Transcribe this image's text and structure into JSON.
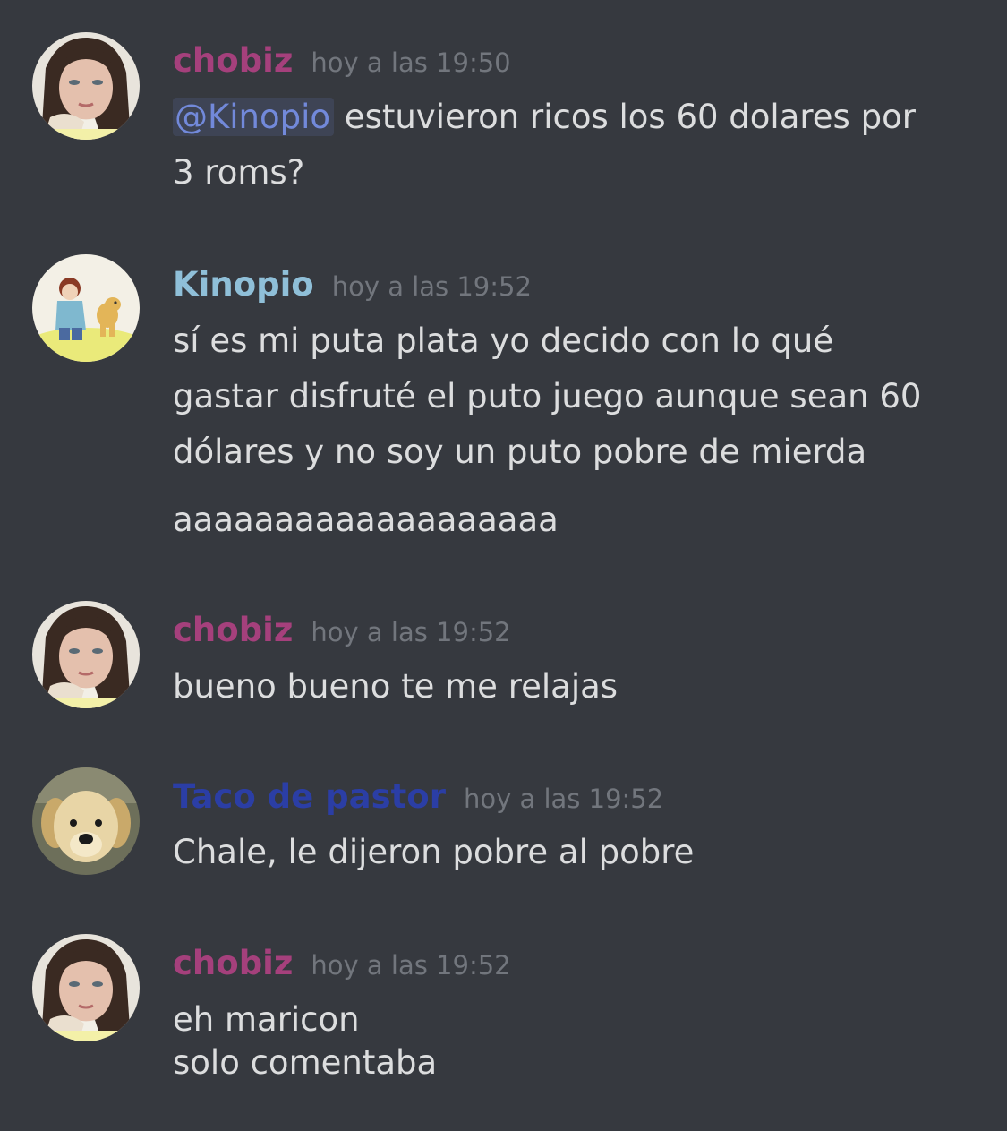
{
  "colors": {
    "background": "#36393f",
    "text": "#dcddde",
    "timestamp": "#72767d",
    "mention": "#7289da",
    "user_chobiz": "#a5407c",
    "user_kinopio": "#8fbfd8",
    "user_taco": "#2b3ea5"
  },
  "messages": [
    {
      "username": "chobiz",
      "timestamp": "hoy a las 19:50",
      "avatar": "girl-portrait-avatar",
      "mention": "@Kinopio",
      "lines": [
        " estuvieron ricos los 60 dolares por",
        "3 roms?"
      ]
    },
    {
      "username": "Kinopio",
      "timestamp": "hoy a las 19:52",
      "avatar": "boy-and-dog-cartoon-avatar",
      "lines": [
        "sí es mi puta plata yo decido con lo qué",
        "gastar disfruté el puto juego aunque sean 60",
        "dólares y no soy un puto pobre de mierda",
        "aaaaaaaaaaaaaaaaaaa"
      ]
    },
    {
      "username": "chobiz",
      "timestamp": "hoy a las 19:52",
      "avatar": "girl-portrait-avatar",
      "lines": [
        "bueno bueno te me relajas"
      ]
    },
    {
      "username": "Taco de pastor",
      "timestamp": "hoy a las 19:52",
      "avatar": "puppy-avatar",
      "lines": [
        "Chale, le dijeron pobre al pobre"
      ]
    },
    {
      "username": "chobiz",
      "timestamp": "hoy a las 19:52",
      "avatar": "girl-portrait-avatar",
      "lines": [
        "eh maricon",
        "solo comentaba"
      ]
    }
  ]
}
